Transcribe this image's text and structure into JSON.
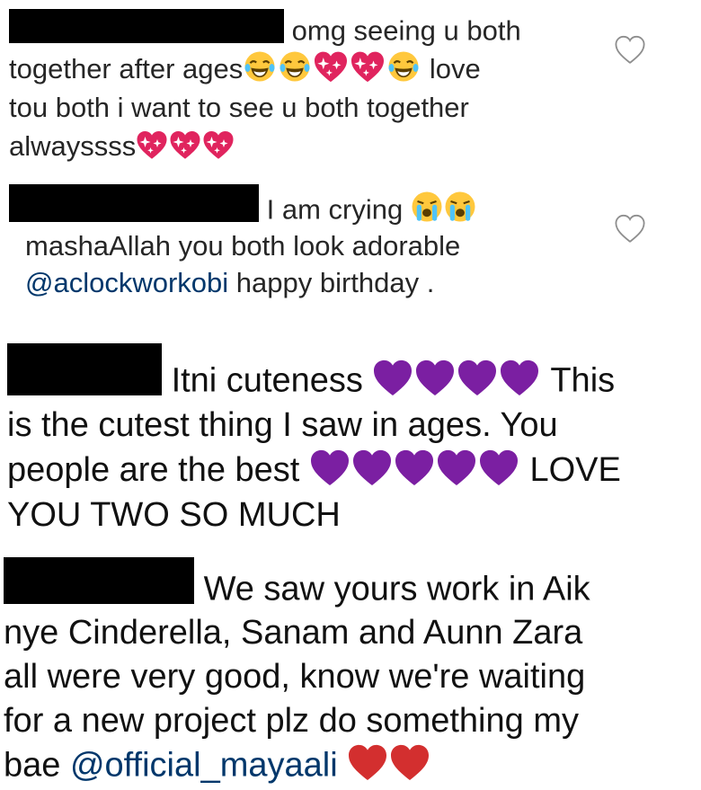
{
  "comments": [
    {
      "line1": "omg seeing  u both",
      "line2a": "together after ages",
      "line2b": "love",
      "line3": "tou both i want to see u both together",
      "line4": "alwayssss"
    },
    {
      "line1": "I am crying",
      "line2": "mashaAllah you both look adorable",
      "mention": "@aclockworkobi",
      "line3_rest": " happy birthday ."
    },
    {
      "line1": "Itni cuteness",
      "line1b": "This",
      "line2": "is the cutest thing I saw in ages. You",
      "line3a": "people are the best",
      "line3b": "LOVE",
      "line4": "YOU TWO SO MUCH"
    },
    {
      "line1": "We saw yours work in Aik",
      "line2": "nye Cinderella, Sanam and Aunn Zara",
      "line3": "all were very good, know we're waiting",
      "line4": "for a new project plz do something my",
      "line5a": "bae ",
      "mention": "@official_mayaali"
    }
  ],
  "icons": {
    "like": "heart-outline-icon",
    "laugh": "face-with-tears-of-joy-icon",
    "sparkle_heart": "sparkling-heart-icon",
    "crying": "loudly-crying-face-icon",
    "purple_heart": "purple-heart-icon",
    "red_heart": "red-heart-icon"
  },
  "colors": {
    "mention": "#00376b",
    "purple_heart": "#7b1fa2",
    "red_heart": "#d32f2f",
    "sparkle_heart": "#e0245e"
  }
}
